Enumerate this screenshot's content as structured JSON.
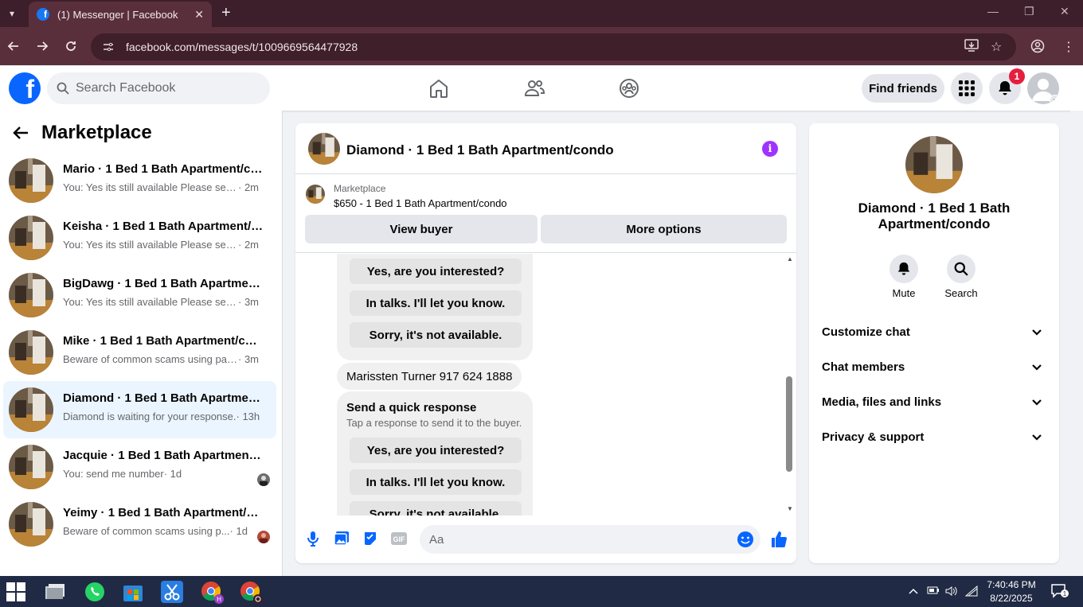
{
  "browser": {
    "tab_title": "(1) Messenger | Facebook",
    "url": "facebook.com/messages/t/1009669564477928"
  },
  "fb_header": {
    "search_placeholder": "Search Facebook",
    "find_friends": "Find friends",
    "notif_count": "1"
  },
  "sidebar": {
    "title": "Marketplace",
    "conversations": [
      {
        "name": "Mario · 1 Bed 1 Bath Apartment/condo",
        "preview": "You: Yes its still available Please send ...",
        "time": "· 2m"
      },
      {
        "name": "Keisha · 1 Bed 1 Bath Apartment/condo",
        "preview": "You: Yes its still available Please send ...",
        "time": "· 2m"
      },
      {
        "name": "BigDawg · 1 Bed 1 Bath Apartment/condo",
        "preview": "You: Yes its still available Please send ...",
        "time": "· 3m"
      },
      {
        "name": "Mike · 1 Bed 1 Bath Apartment/condo",
        "preview": "Beware of common scams using pay...",
        "time": "· 3m"
      },
      {
        "name": "Diamond · 1 Bed 1 Bath Apartment/condo",
        "preview": "Diamond is waiting for your response.",
        "time": "· 13h"
      },
      {
        "name": "Jacquie · 1 Bed 1 Bath Apartment/condo",
        "preview": "You: send me number",
        "time": "· 1d"
      },
      {
        "name": "Yeimy · 1 Bed 1 Bath Apartment/condo",
        "preview": "Beware of common scams using p...",
        "time": "· 1d"
      }
    ]
  },
  "chat": {
    "title": "Diamond · 1 Bed 1 Bath Apartment/condo",
    "marketplace_label": "Marketplace",
    "listing": "$650 - 1 Bed 1 Bath Apartment/condo",
    "view_buyer": "View buyer",
    "more_options": "More options",
    "quick_replies_top": [
      "Yes, are you interested?",
      "In talks. I'll let you know.",
      "Sorry, it's not available."
    ],
    "message": "Marissten Turner 917 624 1888",
    "quick_title": "Send a quick response",
    "quick_sub": "Tap a response to send it to the buyer.",
    "quick_replies_bottom": [
      "Yes, are you interested?",
      "In talks. I'll let you know.",
      "Sorry, it's not available."
    ],
    "composer_placeholder": "Aa"
  },
  "details": {
    "name": "Diamond · 1 Bed 1 Bath Apartment/condo",
    "mute": "Mute",
    "search": "Search",
    "sections": [
      "Customize chat",
      "Chat members",
      "Media, files and links",
      "Privacy & support"
    ]
  },
  "taskbar": {
    "time": "7:40:46 PM",
    "date": "8/22/2025"
  },
  "colors": {
    "fb_blue": "#0866ff",
    "messenger_accent": "#a033ff",
    "active_row": "#ebf5ff",
    "badge_red": "#e41e3f"
  }
}
